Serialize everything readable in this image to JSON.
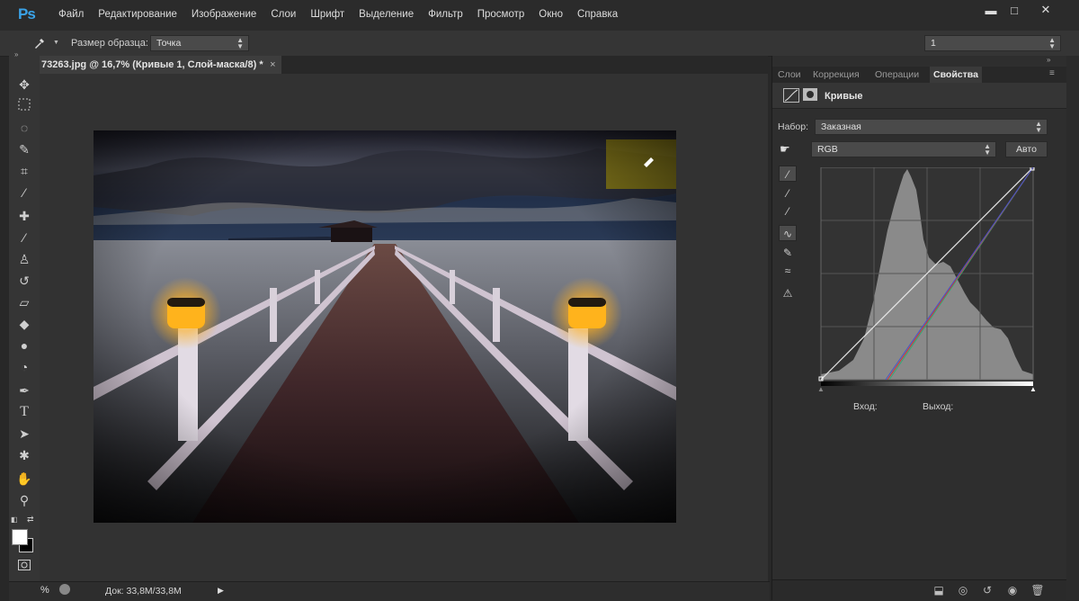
{
  "app": {
    "logo": "Ps",
    "menu": [
      "Файл",
      "Редактирование",
      "Изображение",
      "Слои",
      "Шрифт",
      "Выделение",
      "Фильтр",
      "Просмотр",
      "Окно",
      "Справка"
    ],
    "window_controls": {
      "minimize": "▬",
      "maximize": "□",
      "close": "✕"
    }
  },
  "options_bar": {
    "sample_size_label": "Размер образца:",
    "sample_size_value": "Точка",
    "right_select_value": "1"
  },
  "document": {
    "tab_title": "73263.jpg @ 16,7% (Кривые 1, Слой-маска/8) *",
    "tab_close": "×"
  },
  "status_bar": {
    "zoom_fragment": "%",
    "doc_size": "Док: 33,8M/33,8M",
    "arrow": "▶"
  },
  "panel": {
    "tabs": [
      "Слои",
      "Коррекция",
      "Операции",
      "Свойства"
    ],
    "active_tab": "Свойства",
    "title": "Кривые",
    "preset_label": "Набор:",
    "preset_value": "Заказная",
    "channel_value": "RGB",
    "auto_button": "Авто",
    "input_label": "Вход:",
    "output_label": "Выход:"
  },
  "colors": {
    "accent_ps": "#3aa3e8",
    "panel_bg": "#2e2e2e",
    "canvas_bg": "#323232",
    "lamp_glow": "#ffb020",
    "histogram": "#8a8a8a"
  },
  "icons": {
    "toolbar": [
      "move-icon",
      "marquee-icon",
      "lasso-icon",
      "quick-select-icon",
      "crop-icon",
      "eyedropper-icon",
      "healing-brush-icon",
      "brush-icon",
      "clone-stamp-icon",
      "history-brush-icon",
      "eraser-icon",
      "paint-bucket-icon",
      "blur-icon",
      "dodge-icon",
      "pen-icon",
      "type-icon",
      "path-select-icon",
      "shape-icon",
      "hand-icon",
      "zoom-icon"
    ],
    "curve_tools": [
      "target-adjust-icon",
      "black-point-eyedropper-icon",
      "gray-point-eyedropper-icon",
      "white-point-eyedropper-icon",
      "curve-points-icon",
      "pencil-icon",
      "smooth-icon",
      "clipping-warning-icon"
    ],
    "panel_bottom": [
      "clip-to-layer-icon",
      "view-previous-icon",
      "reset-icon",
      "visibility-icon",
      "delete-icon"
    ]
  }
}
